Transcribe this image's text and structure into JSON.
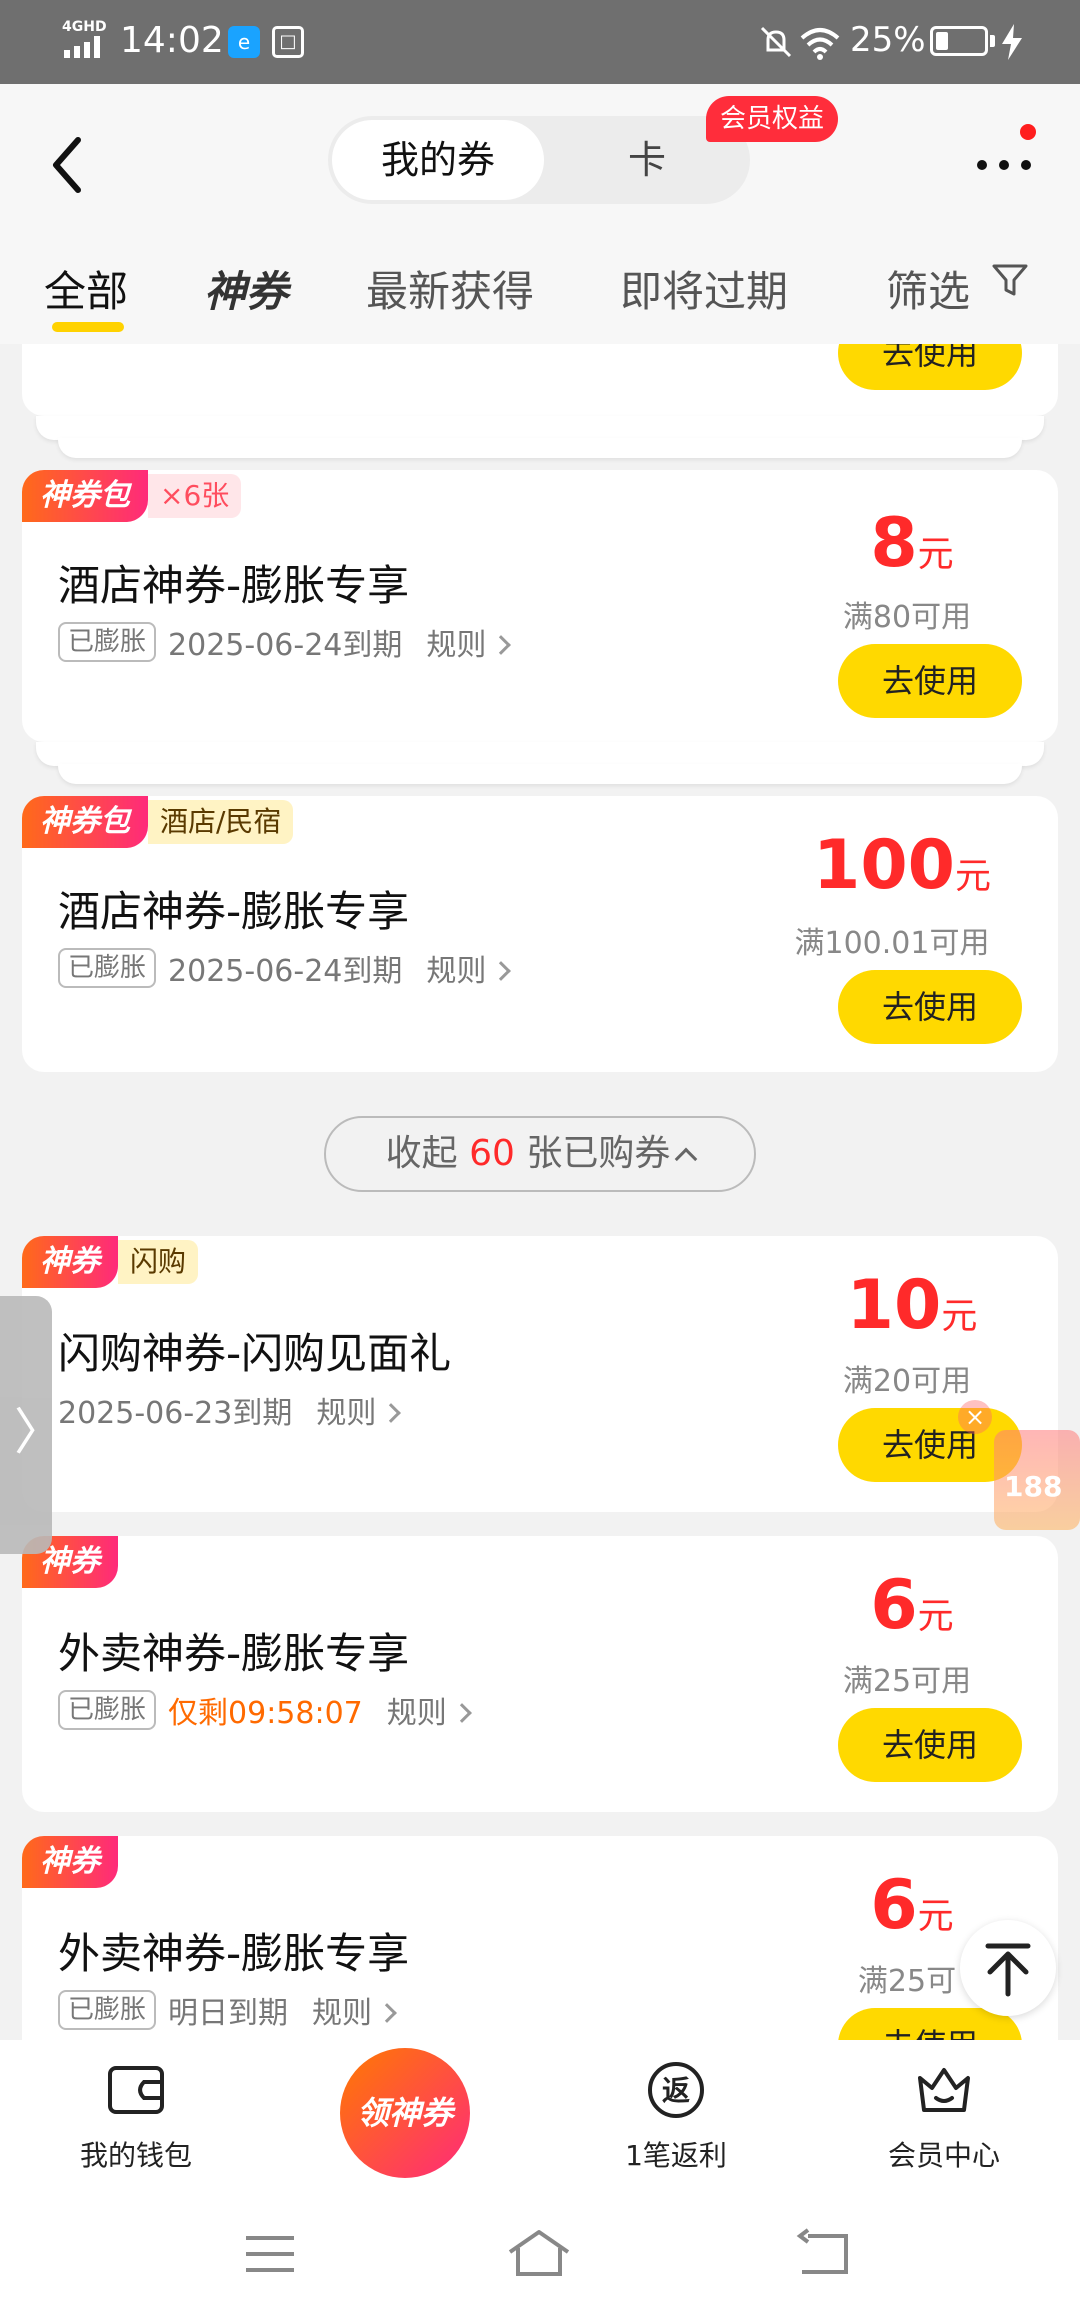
{
  "status": {
    "network": "4GHD",
    "time": "14:02",
    "battery": "25%"
  },
  "header": {
    "seg_active": "我的券",
    "seg_other": "卡",
    "member_badge": "会员权益"
  },
  "tabs": {
    "all": "全部",
    "brand": "神券",
    "latest": "最新获得",
    "expiring": "即将过期",
    "filter": "筛选"
  },
  "cards": [
    {
      "button": "去使用"
    },
    {
      "tag": "神券包",
      "sub": "×6张",
      "title": "酒店神券-膨胀专享",
      "pill": "已膨胀",
      "expiry": "2025-06-24到期",
      "rule": "规则",
      "amount": "8",
      "unit": "元",
      "condition": "满80可用",
      "button": "去使用"
    },
    {
      "tag": "神券包",
      "sub": "酒店/民宿",
      "title": "酒店神券-膨胀专享",
      "pill": "已膨胀",
      "expiry": "2025-06-24到期",
      "rule": "规则",
      "amount": "100",
      "unit": "元",
      "condition": "满100.01可用",
      "button": "去使用"
    },
    {
      "tag": "神券",
      "sub": "闪购",
      "title": "闪购神券-闪购见面礼",
      "expiry": "2025-06-23到期",
      "rule": "规则",
      "amount": "10",
      "unit": "元",
      "condition": "满20可用",
      "button": "去使用"
    },
    {
      "tag": "神券",
      "title": "外卖神券-膨胀专享",
      "pill": "已膨胀",
      "expiry": "仅剩09:58:07",
      "rule": "规则",
      "amount": "6",
      "unit": "元",
      "condition": "满25可用",
      "button": "去使用"
    },
    {
      "tag": "神券",
      "title": "外卖神券-膨胀专享",
      "pill": "已膨胀",
      "expiry": "明日到期",
      "rule": "规则",
      "amount": "6",
      "unit": "元",
      "condition": "满25可",
      "button": "去使用"
    }
  ],
  "collapse": {
    "prefix": "收起",
    "count": "60",
    "suffix": "张已购券"
  },
  "float_promo": {
    "value": "188"
  },
  "bottom_nav": {
    "wallet": "我的钱包",
    "center": "领神券",
    "rebate": "1笔返利",
    "member": "会员中心"
  }
}
